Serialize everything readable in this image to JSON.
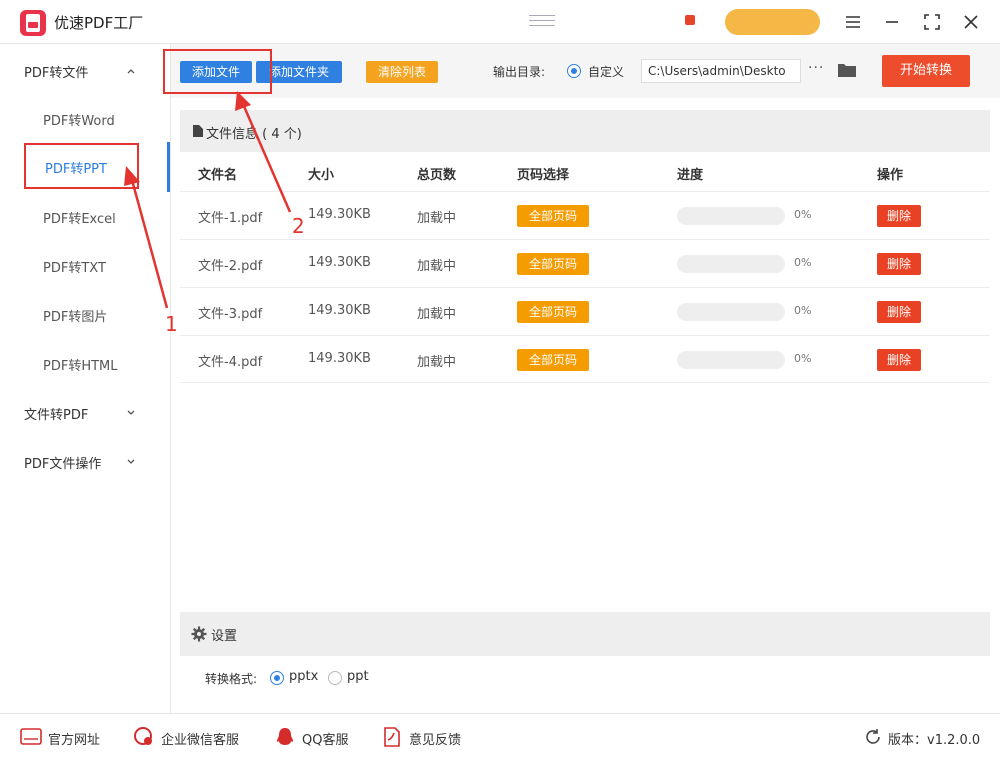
{
  "app": {
    "title": "优速PDF工厂"
  },
  "sidebar": {
    "groups": [
      {
        "label": "PDF转文件",
        "expanded": true
      },
      {
        "label": "文件转PDF",
        "expanded": false
      },
      {
        "label": "PDF文件操作",
        "expanded": false
      }
    ],
    "items": [
      "PDF转Word",
      "PDF转PPT",
      "PDF转Excel",
      "PDF转TXT",
      "PDF转图片",
      "PDF转HTML"
    ],
    "active_item": "PDF转PPT"
  },
  "toolbar": {
    "add_file": "添加文件",
    "add_folder": "添加文件夹",
    "clear_list": "清除列表",
    "output_label": "输出目录:",
    "output_custom": "自定义",
    "output_path": "C:\\Users\\admin\\Deskto",
    "more": "···",
    "start": "开始转换"
  },
  "file_panel": {
    "title": "文件信息",
    "count": "( 4 个)",
    "columns": [
      "文件名",
      "大小",
      "总页数",
      "页码选择",
      "进度",
      "操作"
    ],
    "rows": [
      {
        "name": "文件-1.pdf",
        "size": "149.30KB",
        "pages": "加载中",
        "page_select": "全部页码",
        "progress": "0%",
        "progress_value": 0,
        "action": "删除"
      },
      {
        "name": "文件-2.pdf",
        "size": "149.30KB",
        "pages": "加载中",
        "page_select": "全部页码",
        "progress": "0%",
        "progress_value": 0,
        "action": "删除"
      },
      {
        "name": "文件-3.pdf",
        "size": "149.30KB",
        "pages": "加载中",
        "page_select": "全部页码",
        "progress": "0%",
        "progress_value": 0,
        "action": "删除"
      },
      {
        "name": "文件-4.pdf",
        "size": "149.30KB",
        "pages": "加载中",
        "page_select": "全部页码",
        "progress": "0%",
        "progress_value": 0,
        "action": "删除"
      }
    ]
  },
  "settings": {
    "title": "设置",
    "format_label": "转换格式:",
    "options": [
      "pptx",
      "ppt"
    ],
    "selected": "pptx"
  },
  "footer": {
    "website": "官方网址",
    "wechat": "企业微信客服",
    "qq": "QQ客服",
    "feedback": "意见反馈",
    "version": "版本：v1.2.0.0"
  },
  "annotations": {
    "step1": "1",
    "step2": "2"
  },
  "colors": {
    "accent": "#2f80e0",
    "danger": "#e94123",
    "warning": "#f59c00",
    "annotation": "#e3342f"
  }
}
